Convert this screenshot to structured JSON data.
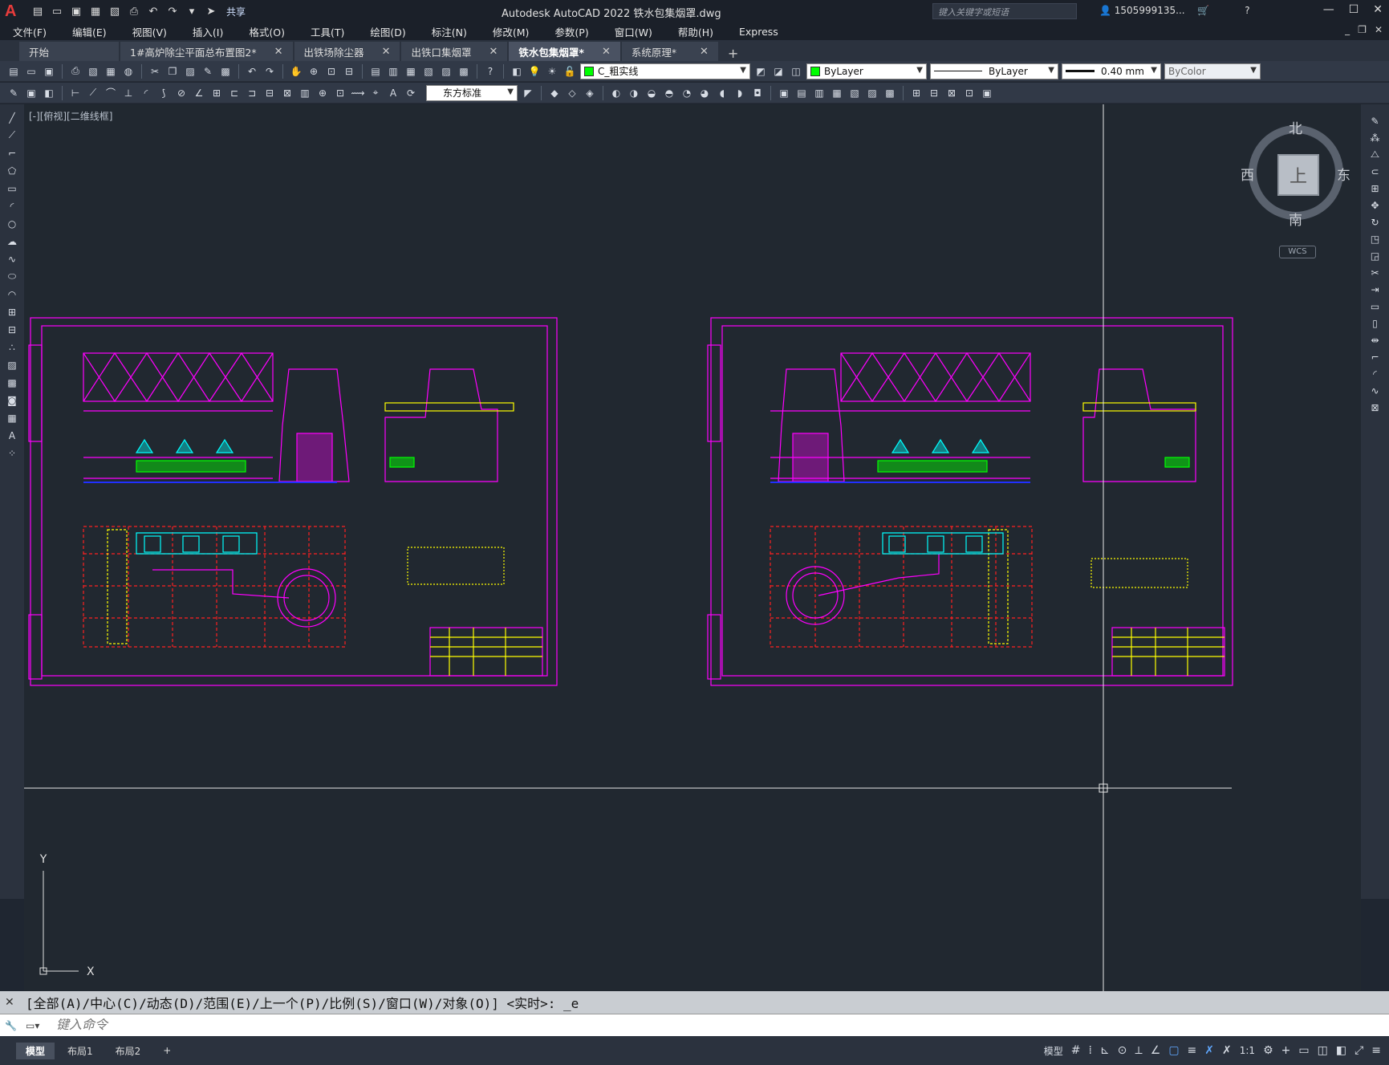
{
  "app": {
    "logo": "A",
    "title": "Autodesk AutoCAD 2022    铁水包集烟罩.dwg",
    "share": "共享"
  },
  "search": {
    "placeholder": "键入关键字或短语"
  },
  "user": {
    "name": "1505999135..."
  },
  "menu": [
    "文件(F)",
    "编辑(E)",
    "视图(V)",
    "插入(I)",
    "格式(O)",
    "工具(T)",
    "绘图(D)",
    "标注(N)",
    "修改(M)",
    "参数(P)",
    "窗口(W)",
    "帮助(H)",
    "Express"
  ],
  "tabs": [
    {
      "label": "开始"
    },
    {
      "label": "1#高炉除尘平面总布置图2*"
    },
    {
      "label": "出铁场除尘器"
    },
    {
      "label": "出铁口集烟罩"
    },
    {
      "label": "铁水包集烟罩*",
      "active": true
    },
    {
      "label": "系统原理*"
    }
  ],
  "properties": {
    "layer": "C_粗实线",
    "color": "ByLayer",
    "linetype": "ByLayer",
    "lineweight": "0.40 mm",
    "plotstyle": "ByColor",
    "dimstyle": "东方标准",
    "layer_color": "#00ff00"
  },
  "viewport": {
    "label": "[-][俯视][二维线框]"
  },
  "viewcube": {
    "north": "北",
    "south": "南",
    "east": "东",
    "west": "西",
    "top": "上",
    "wcs": "WCS"
  },
  "command": {
    "history": "[全部(A)/中心(C)/动态(D)/范围(E)/上一个(P)/比例(S)/窗口(W)/对象(O)] <实时>: _e",
    "placeholder": "键入命令"
  },
  "layout_tabs": [
    {
      "label": "模型",
      "active": true
    },
    {
      "label": "布局1"
    },
    {
      "label": "布局2"
    }
  ],
  "status": {
    "model": "模型",
    "scale": "1:1"
  },
  "colors": {
    "magenta": "#ff00ff",
    "cyan": "#00ffff",
    "green": "#00ff00",
    "yellow": "#ffff00",
    "red": "#ff2020"
  }
}
